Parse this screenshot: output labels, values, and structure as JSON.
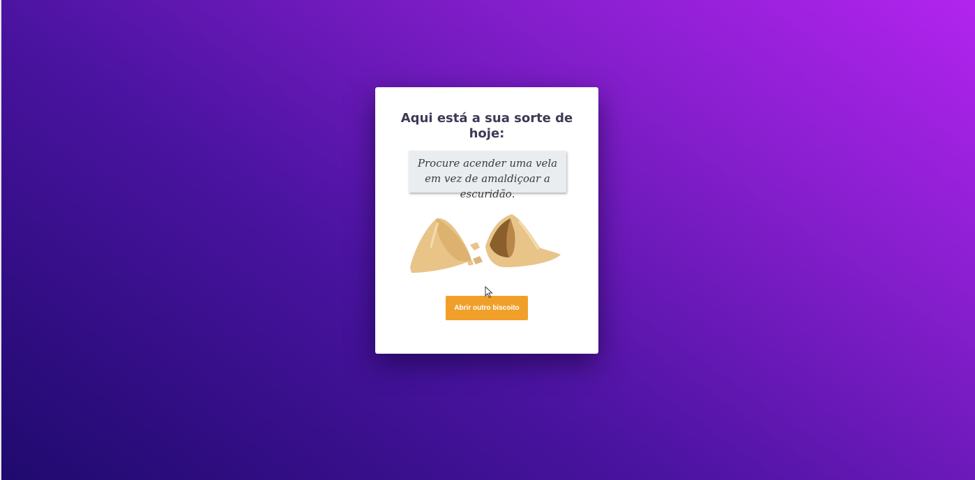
{
  "card": {
    "title": "Aqui está a sua sorte de hoje:",
    "fortune": "Procure acender uma vela em vez de amaldiçoar a escuridão.",
    "button_label": "Abrir outro biscoito"
  },
  "icons": {
    "cookie": "broken-fortune-cookie-illustration",
    "cursor": "mouse-pointer-icon"
  },
  "colors": {
    "background_start": "#1f0a6e",
    "background_end": "#b224ee",
    "button": "#f0a02a",
    "title_text": "#3c3a55",
    "paper": "#e9edf0"
  }
}
